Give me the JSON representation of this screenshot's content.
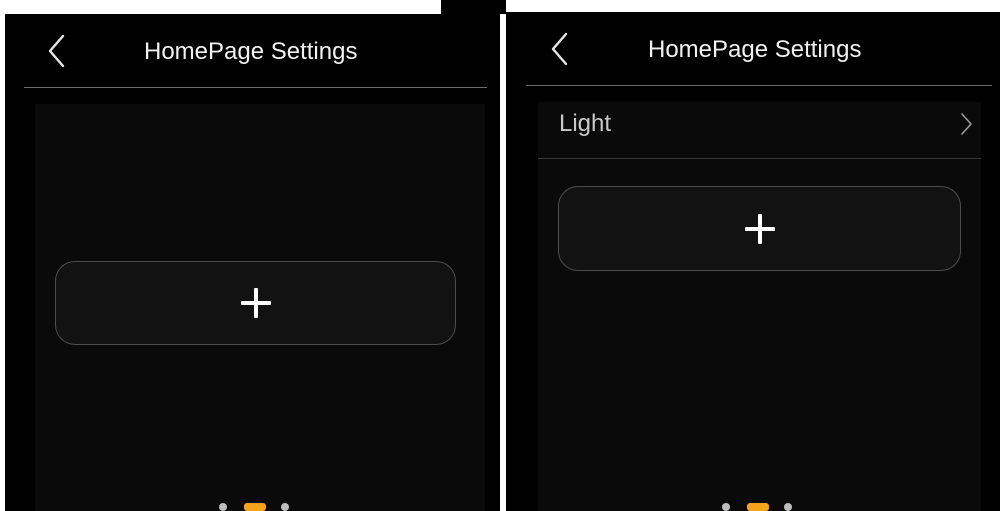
{
  "screens": [
    {
      "header": {
        "title": "HomePage Settings",
        "back_icon": "chevron-left-icon"
      },
      "add_button": {
        "icon": "plus-icon"
      },
      "pagination": {
        "total": 3,
        "active_index": 1
      }
    },
    {
      "header": {
        "title": "HomePage Settings",
        "back_icon": "chevron-left-icon"
      },
      "list": [
        {
          "label": "Light",
          "icon": "chevron-right-icon"
        }
      ],
      "add_button": {
        "icon": "plus-icon"
      },
      "pagination": {
        "total": 3,
        "active_index": 1
      }
    }
  ],
  "colors": {
    "background": "#000000",
    "text": "#f2f2f2",
    "muted_text": "#c8c8c8",
    "accent": "#f5a31a",
    "card_border": "#4d4d4d"
  }
}
